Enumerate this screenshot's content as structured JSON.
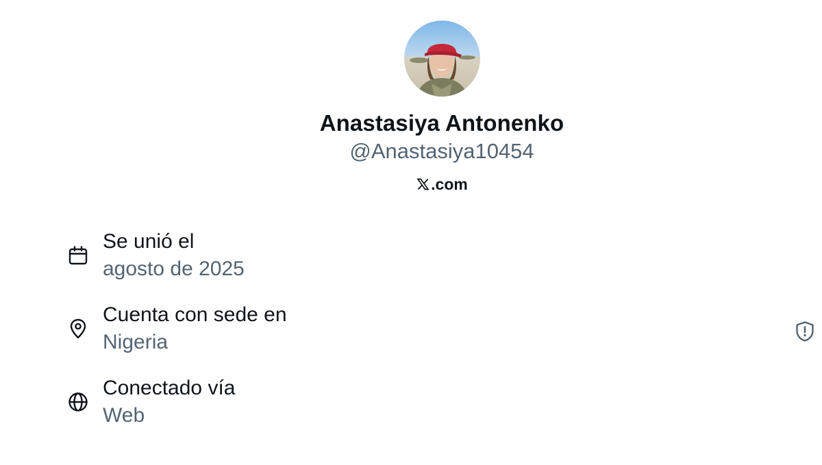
{
  "profile": {
    "display_name": "Anastasiya Antonenko",
    "handle": "@Anastasiya10454",
    "source_label": ".com",
    "source_icon": "x-logo-icon",
    "avatar_icon": "profile-photo"
  },
  "about": {
    "rows": [
      {
        "icon": "calendar-icon",
        "label": "Se unió el",
        "value": "agosto de 2025"
      },
      {
        "icon": "location-pin-icon",
        "label": "Cuenta con sede en",
        "value": "Nigeria",
        "badge_icon": "shield-alert-icon"
      },
      {
        "icon": "globe-icon",
        "label": "Conectado vía",
        "value": "Web"
      }
    ]
  },
  "colors": {
    "primary_text": "#0f1419",
    "secondary_text": "#536471",
    "background": "#ffffff"
  }
}
